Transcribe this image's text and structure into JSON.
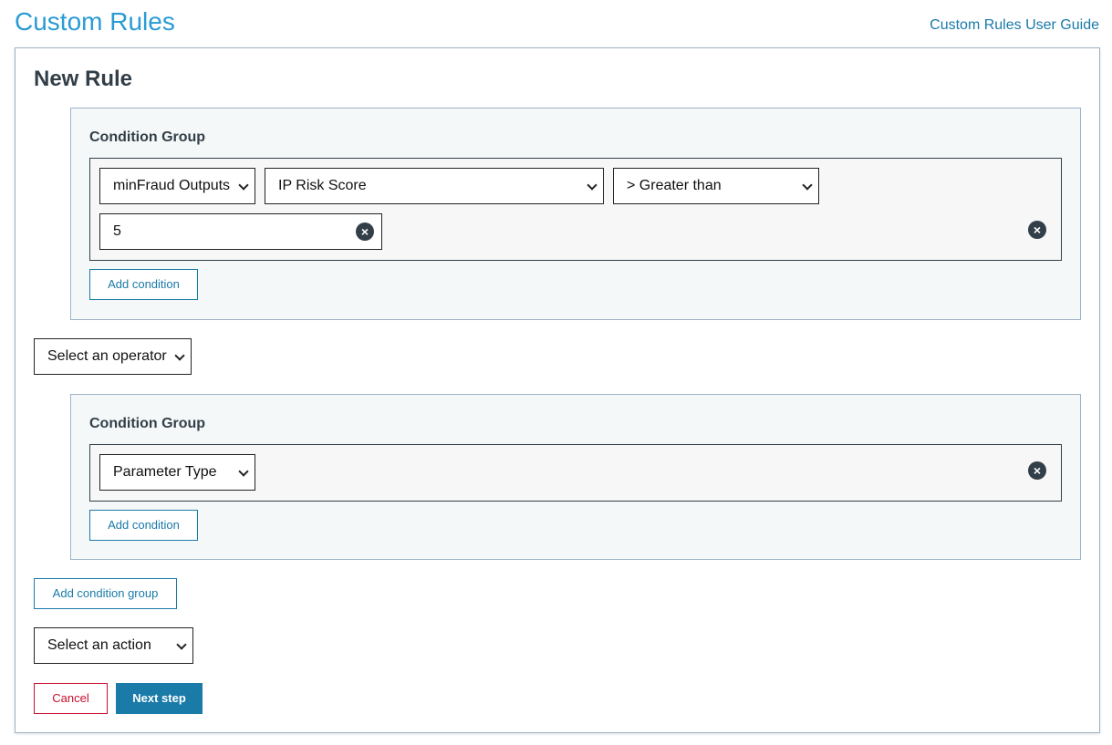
{
  "header": {
    "title": "Custom Rules",
    "guide_link": "Custom Rules User Guide"
  },
  "rule": {
    "title": "New Rule",
    "groups": [
      {
        "label": "Condition Group",
        "condition": {
          "category": "minFraud Outputs",
          "field": "IP Risk Score",
          "comparator": "> Greater than",
          "value": "5"
        },
        "add_condition_label": "Add condition"
      },
      {
        "label": "Condition Group",
        "condition": {
          "category": "Parameter Type"
        },
        "add_condition_label": "Add condition"
      }
    ],
    "operator_select": "Select an operator",
    "add_group_label": "Add condition group",
    "action_select": "Select an action",
    "cancel_label": "Cancel",
    "next_label": "Next step"
  },
  "icons": {
    "clear": "close-circle-icon",
    "remove": "close-circle-icon",
    "dropdown": "chevron-down-icon"
  },
  "colors": {
    "brand": "#2a9bd3",
    "primary": "#1a7aa8",
    "danger": "#c8102e",
    "text": "#333f48"
  }
}
